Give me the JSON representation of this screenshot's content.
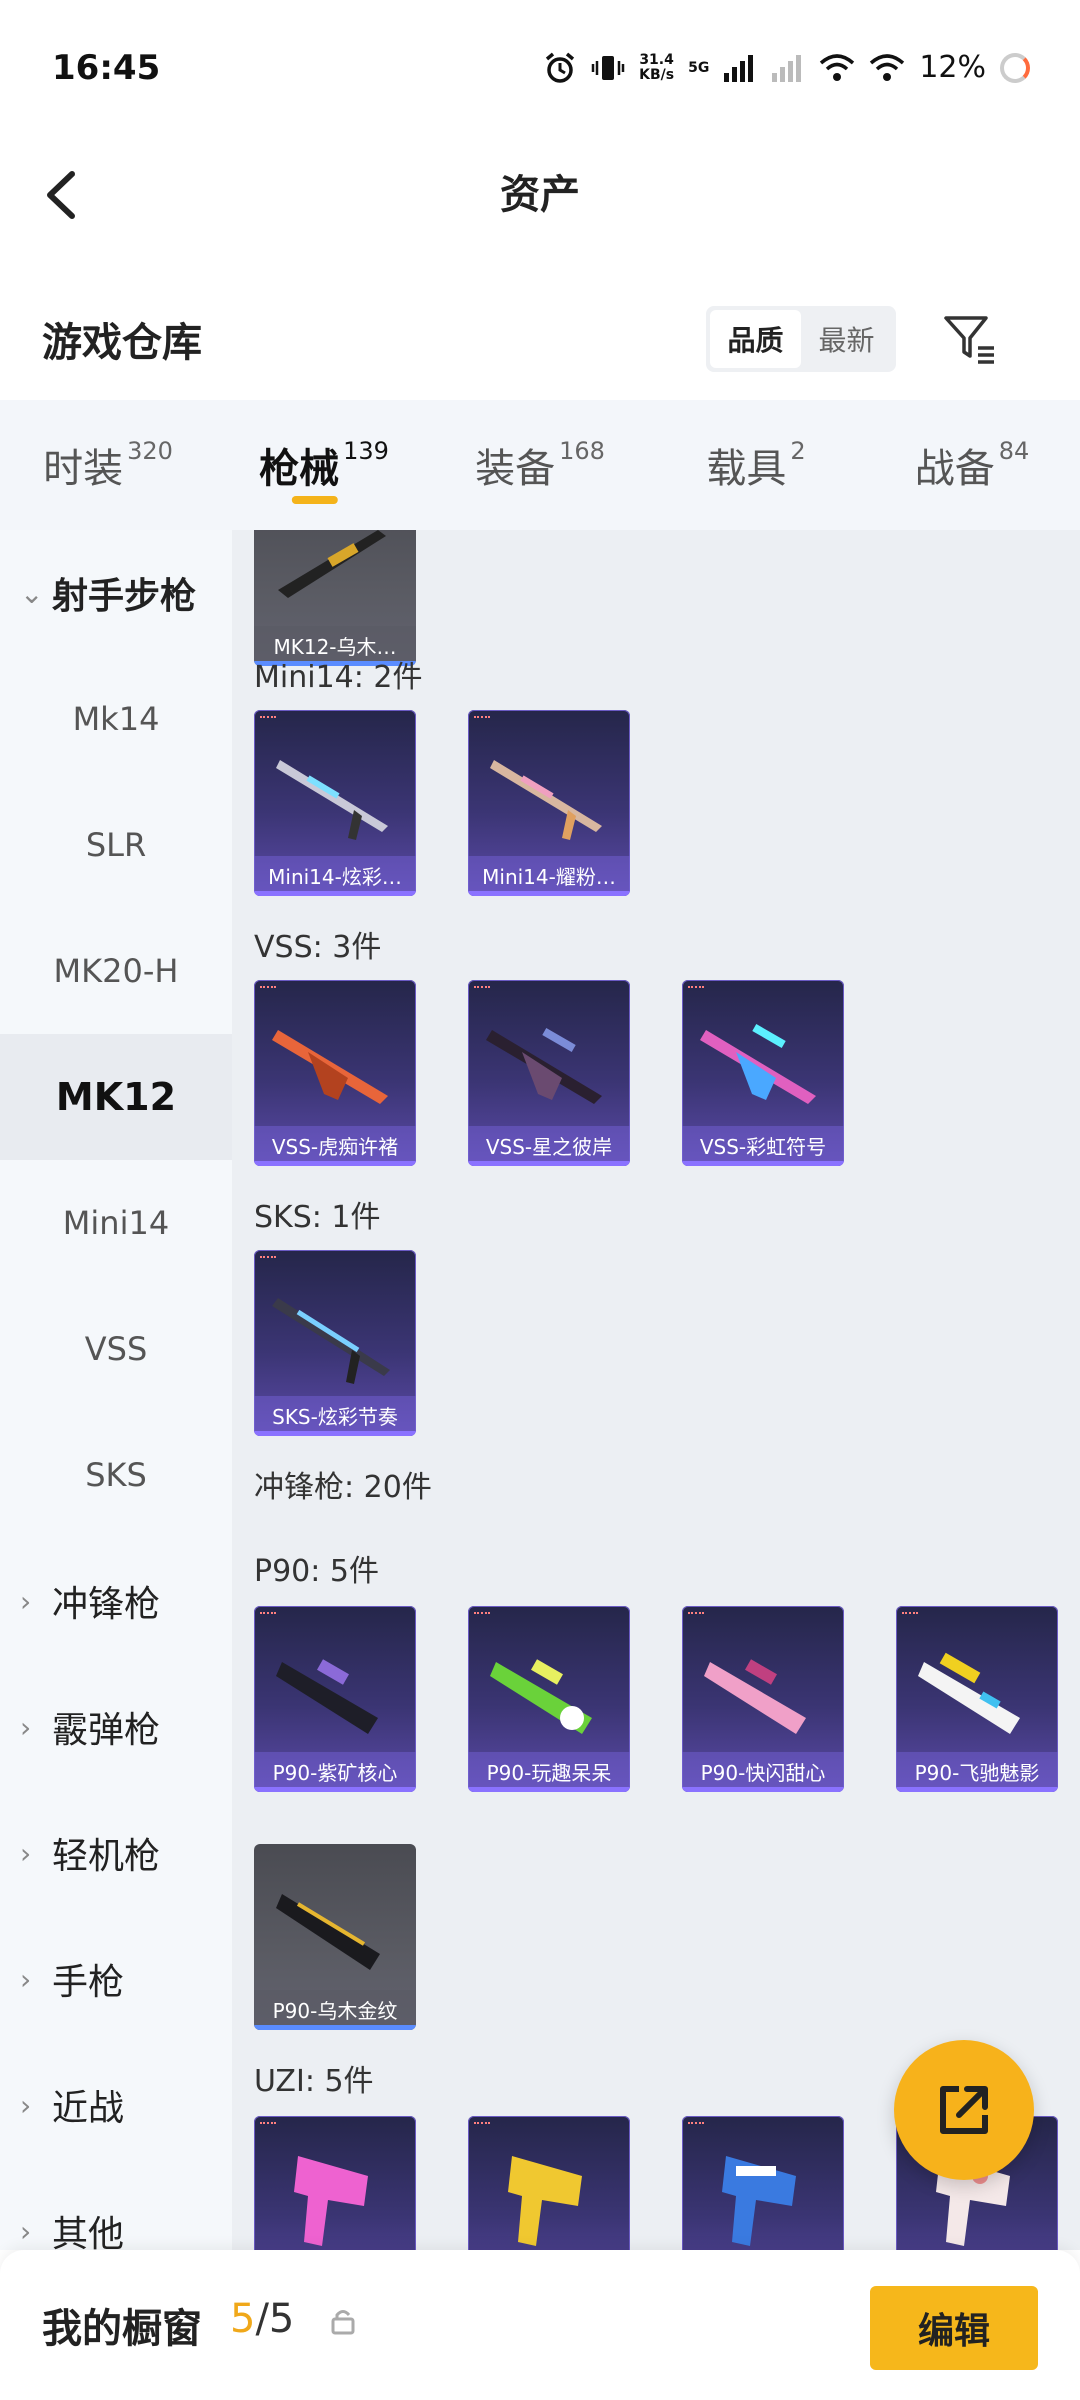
{
  "status_bar": {
    "time": "16:45",
    "speed_value": "31.4",
    "speed_unit": "KB/s",
    "network": "5G",
    "battery": "12%"
  },
  "header": {
    "title": "资产"
  },
  "warehouse": {
    "title": "游戏仓库",
    "sort_options": [
      "品质",
      "最新"
    ],
    "sort_active": "品质"
  },
  "category_tabs": [
    {
      "label": "时装",
      "count": "320"
    },
    {
      "label": "枪械",
      "count": "139",
      "active": true
    },
    {
      "label": "装备",
      "count": "168"
    },
    {
      "label": "载具",
      "count": "2"
    },
    {
      "label": "战备",
      "count": "84"
    }
  ],
  "sidebar": {
    "items": [
      {
        "type": "group",
        "label": "射手步枪",
        "expanded": true
      },
      {
        "type": "sub",
        "label": "Mk14"
      },
      {
        "type": "sub",
        "label": "SLR"
      },
      {
        "type": "sub",
        "label": "MK20-H"
      },
      {
        "type": "sub",
        "label": "MK12",
        "active": true
      },
      {
        "type": "sub",
        "label": "Mini14"
      },
      {
        "type": "sub",
        "label": "VSS"
      },
      {
        "type": "sub",
        "label": "SKS"
      },
      {
        "type": "group",
        "label": "冲锋枪"
      },
      {
        "type": "group",
        "label": "霰弹枪"
      },
      {
        "type": "group",
        "label": "轻机枪"
      },
      {
        "type": "group",
        "label": "手枪"
      },
      {
        "type": "group",
        "label": "近战"
      },
      {
        "type": "group",
        "label": "其他"
      }
    ]
  },
  "content": {
    "top_item": {
      "name": "MK12-乌木…"
    },
    "sections": [
      {
        "heading": "Mini14: 2件",
        "items": [
          {
            "name": "Mini14-炫彩…"
          },
          {
            "name": "Mini14-耀粉…"
          }
        ]
      },
      {
        "heading": "VSS: 3件",
        "items": [
          {
            "name": "VSS-虎痴许褚"
          },
          {
            "name": "VSS-星之彼岸"
          },
          {
            "name": "VSS-彩虹符号"
          }
        ]
      },
      {
        "heading": "SKS: 1件",
        "items": [
          {
            "name": "SKS-炫彩节奏"
          }
        ]
      },
      {
        "heading": "冲锋枪: 20件"
      },
      {
        "heading": "P90: 5件",
        "items": [
          {
            "name": "P90-紫矿核心"
          },
          {
            "name": "P90-玩趣呆呆"
          },
          {
            "name": "P90-快闪甜心"
          },
          {
            "name": "P90-飞驰魅影"
          },
          {
            "name": "P90-乌木金纹"
          }
        ]
      },
      {
        "heading": "UZI: 5件"
      }
    ]
  },
  "bottom_bar": {
    "title": "我的橱窗",
    "count_current": "5",
    "count_sep_total": "/5",
    "edit_label": "编辑"
  },
  "colors": {
    "accent": "#f6b71b",
    "item_purple": "#3b3574",
    "item_gray": "#5a5b63"
  }
}
